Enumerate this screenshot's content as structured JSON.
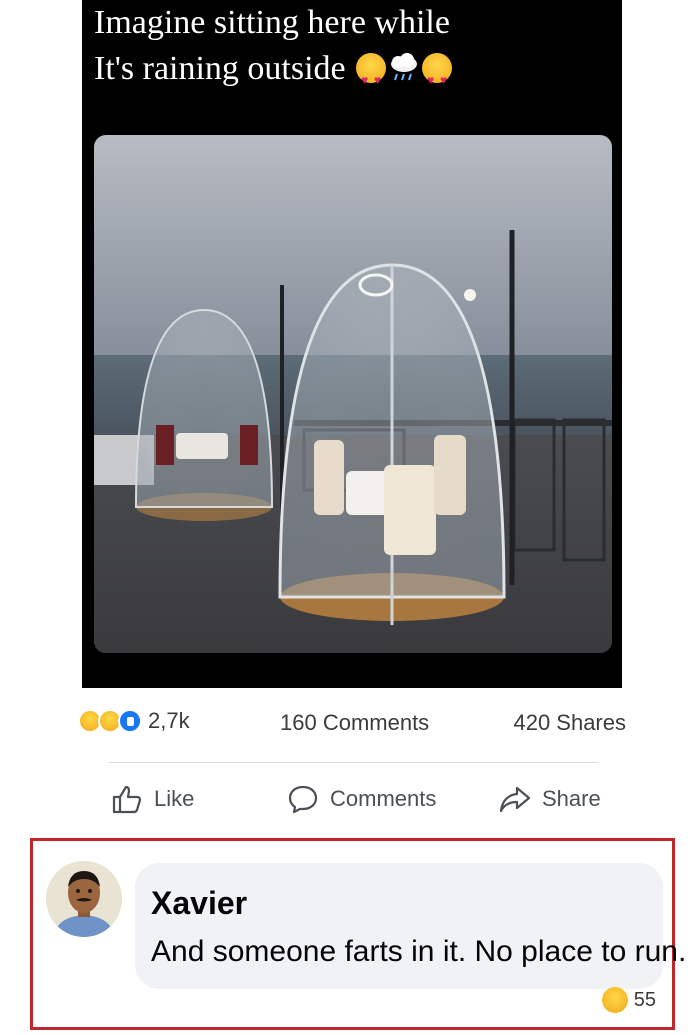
{
  "post": {
    "caption_line1": "Imagine sitting here while",
    "caption_line2": "It's raining outside",
    "caption_emojis": [
      "heart-eyes-icon",
      "rain-cloud-icon",
      "heart-eyes-icon"
    ],
    "reaction_icons": [
      "haha-icon",
      "wow-icon",
      "like-icon"
    ],
    "reaction_count": "2,7k",
    "comments_count": "160 Comments",
    "shares_count": "420 Shares"
  },
  "actions": {
    "like_label": "Like",
    "comment_label": "Comments",
    "share_label": "Share"
  },
  "comment": {
    "author": "Xavier",
    "text": "And someone farts in it. No place to run.",
    "reaction_icon": "haha-icon",
    "reaction_count": "55"
  },
  "colors": {
    "like_blue": "#1877f2",
    "highlight_border": "#c0282e",
    "bubble_bg": "#f0f2f5"
  }
}
